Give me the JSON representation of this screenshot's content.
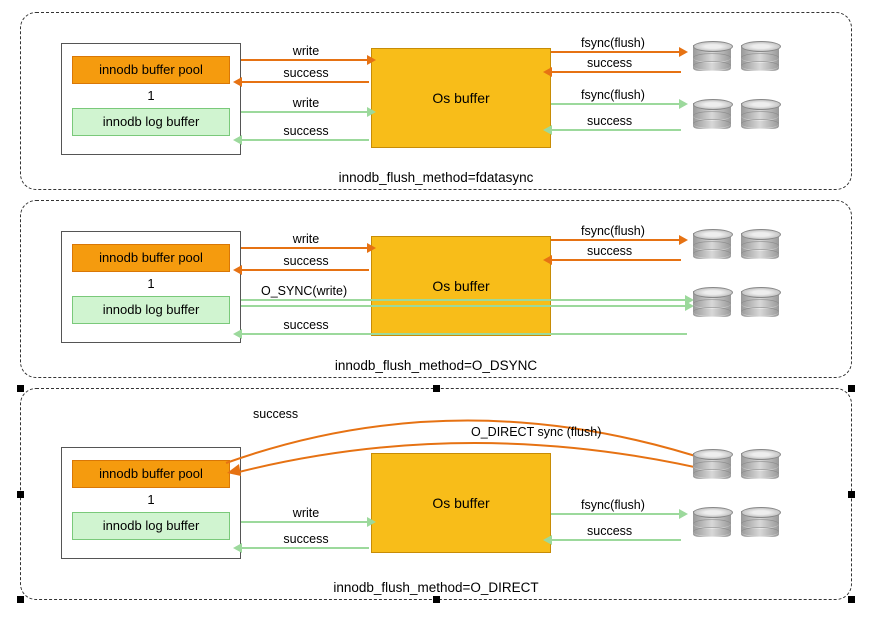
{
  "panels": [
    {
      "innodb": {
        "pool": "innodb buffer pool",
        "one": "1",
        "log": "innodb log buffer"
      },
      "os": "Os buffer",
      "caption": "innodb_flush_method=fdatasync",
      "rows": {
        "pool_write": "write",
        "pool_success": "success",
        "log_write": "write",
        "log_success": "success",
        "pool_fsync": "fsync(flush)",
        "pool_r_success": "success",
        "log_fsync": "fsync(flush)",
        "log_r_success": "success"
      }
    },
    {
      "innodb": {
        "pool": "innodb buffer pool",
        "one": "1",
        "log": "innodb log buffer"
      },
      "os": "Os buffer",
      "caption": "innodb_flush_method=O_DSYNC",
      "rows": {
        "pool_write": "write",
        "pool_success": "success",
        "log_osync": "O_SYNC(write)",
        "log_success": "success",
        "pool_fsync": "fsync(flush)",
        "pool_r_success": "success"
      }
    },
    {
      "innodb": {
        "pool": "innodb buffer pool",
        "one": "1",
        "log": "innodb log buffer"
      },
      "os": "Os buffer",
      "caption": "innodb_flush_method=O_DIRECT",
      "rows": {
        "top_success": "success",
        "top_odirect": "O_DIRECT   sync (flush)",
        "log_write": "write",
        "log_success": "success",
        "log_fsync": "fsync(flush)",
        "log_r_success": "success"
      }
    }
  ]
}
